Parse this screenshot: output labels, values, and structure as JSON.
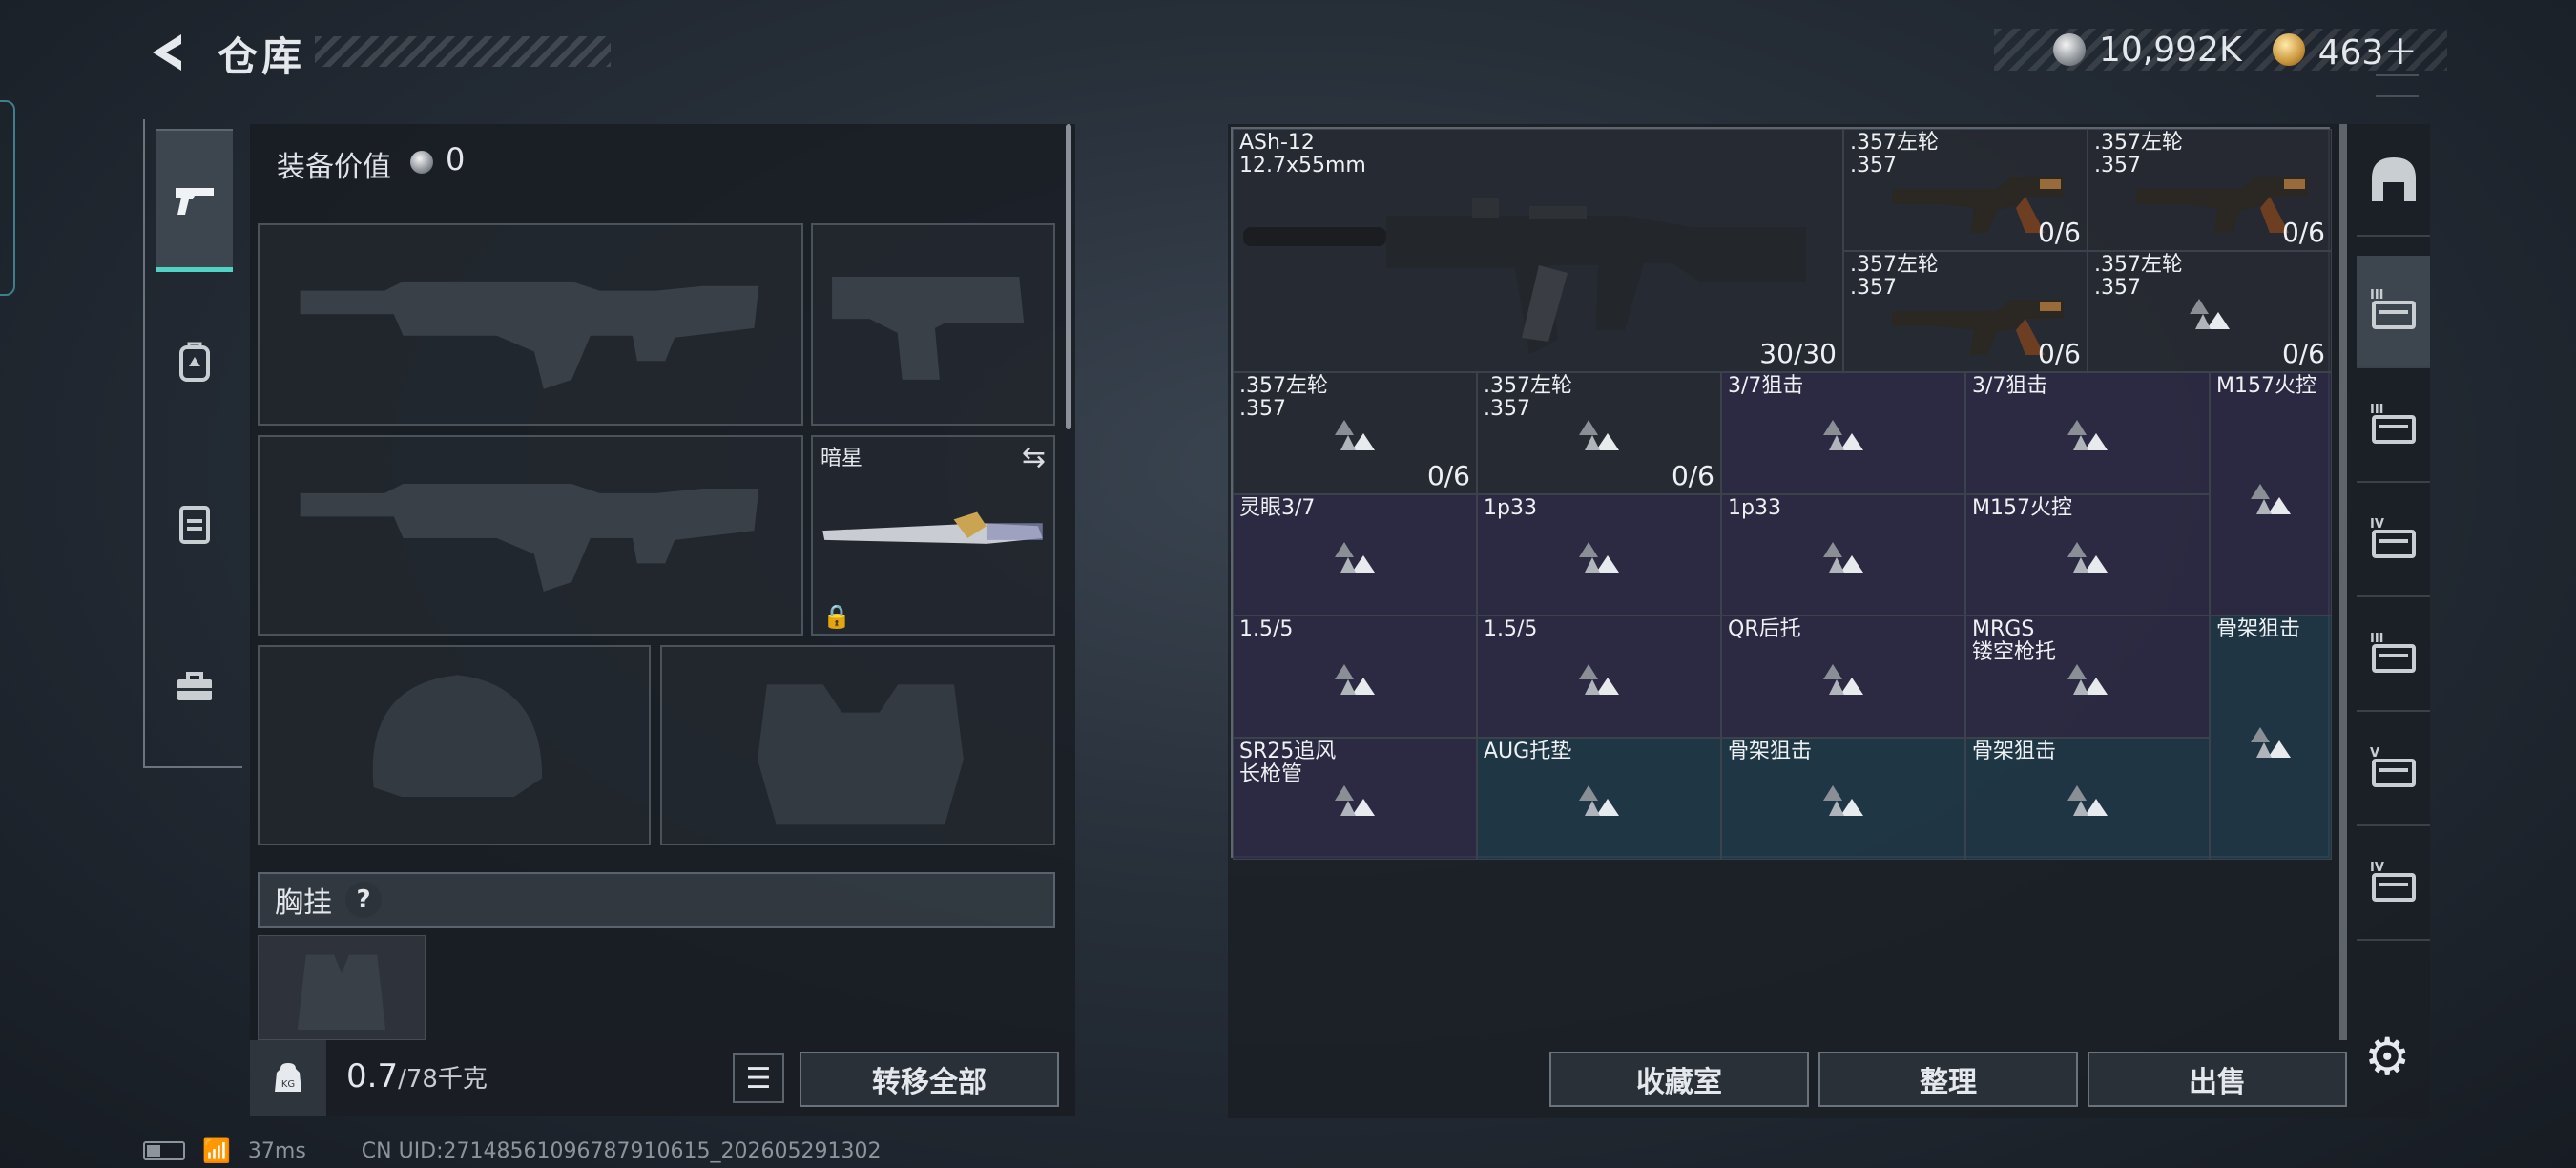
{
  "header": {
    "title": "仓库",
    "currency": [
      {
        "icon": "silver-coin-icon",
        "value": "10,992K"
      },
      {
        "icon": "gold-coin-icon",
        "value": "463＋"
      }
    ]
  },
  "left_tabs": [
    {
      "icon": "pistol-icon",
      "active": true
    },
    {
      "icon": "backpack-icon",
      "active": false
    },
    {
      "icon": "vest-icon",
      "active": false
    },
    {
      "icon": "toolbox-icon",
      "active": false
    }
  ],
  "equipment": {
    "value_label": "装备价值",
    "value": "0",
    "knife_label": "暗星",
    "chest_label": "胸挂",
    "help_label": "?"
  },
  "bottom": {
    "weight": "0.7",
    "weight_max": "/78千克",
    "transfer_label": "转移全部",
    "kg_label": "KG"
  },
  "status": {
    "ping": "37ms",
    "uid": "CN UID:27148561096787910615_202605291302"
  },
  "storage": {
    "items": [
      {
        "name": "ASh-12\n12.7x55mm",
        "count": "30/30"
      },
      {
        "name": ".357左轮\n.357",
        "count": "0/6"
      },
      {
        "name": ".357左轮\n.357",
        "count": "0/6"
      },
      {
        "name": ".357左轮\n.357",
        "count": "0/6"
      },
      {
        "name": ".357左轮\n.357",
        "count": "0/6"
      },
      {
        "name": ".357左轮\n.357",
        "count": "0/6"
      },
      {
        "name": ".357左轮\n.357",
        "count": "0/6"
      },
      {
        "name": "3/7狙击",
        "count": ""
      },
      {
        "name": "3/7狙击",
        "count": ""
      },
      {
        "name": "M157火控",
        "count": ""
      },
      {
        "name": "灵眼3/7",
        "count": ""
      },
      {
        "name": "1p33",
        "count": ""
      },
      {
        "name": "1p33",
        "count": ""
      },
      {
        "name": "M157火控",
        "count": ""
      },
      {
        "name": "1.5/5",
        "count": ""
      },
      {
        "name": "1.5/5",
        "count": ""
      },
      {
        "name": "QR后托",
        "count": ""
      },
      {
        "name": "MRGS\n镂空枪托",
        "count": ""
      },
      {
        "name": "骨架狙击",
        "count": ""
      },
      {
        "name": "SR25追风\n长枪管",
        "count": ""
      },
      {
        "name": "AUG托垫",
        "count": ""
      },
      {
        "name": "骨架狙击",
        "count": ""
      },
      {
        "name": "骨架狙击",
        "count": ""
      }
    ]
  },
  "right_buttons": [
    "收藏室",
    "整理",
    "出售"
  ],
  "right_tabs": [
    {
      "icon": "home-icon",
      "roman": ""
    },
    {
      "icon": "weapon-rack-3-icon",
      "roman": "III"
    },
    {
      "icon": "weapon-rack-3b-icon",
      "roman": "III"
    },
    {
      "icon": "folder-4-icon",
      "roman": "IV"
    },
    {
      "icon": "case-3-icon",
      "roman": "III"
    },
    {
      "icon": "crate-5-icon",
      "roman": "V"
    },
    {
      "icon": "crate-4-icon",
      "roman": "IV"
    }
  ],
  "colors": {
    "accent": "#4fd3c4",
    "cell_purple": "#2e2c46",
    "cell_blue": "#203a4a"
  }
}
